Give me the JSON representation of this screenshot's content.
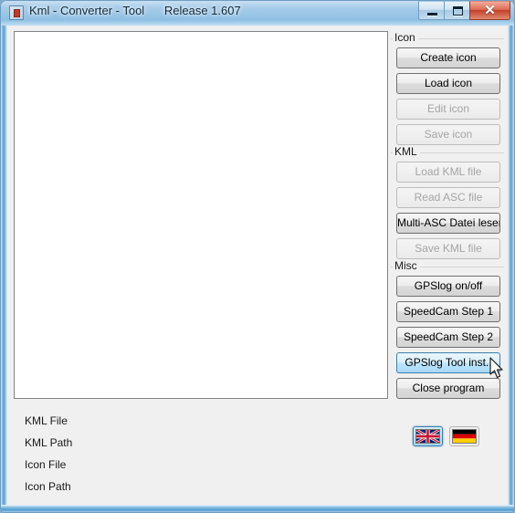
{
  "window": {
    "title": "Kml - Converter - Tool      Release 1.607",
    "app_icon_name": "kml-app-icon",
    "controls": {
      "minimize_label": "",
      "maximize_label": "",
      "close_label": "✕"
    }
  },
  "canvas": {
    "content": ""
  },
  "groups": [
    {
      "name": "icon",
      "label": "Icon",
      "buttons": [
        {
          "label": "Create icon",
          "state": "enabled"
        },
        {
          "label": "Load icon",
          "state": "enabled"
        },
        {
          "label": "Edit icon",
          "state": "disabled"
        },
        {
          "label": "Save icon",
          "state": "disabled"
        }
      ]
    },
    {
      "name": "kml",
      "label": "KML",
      "buttons": [
        {
          "label": "Load KML file",
          "state": "disabled"
        },
        {
          "label": "Read ASC file",
          "state": "disabled"
        },
        {
          "label": "Multi-ASC Datei lesen",
          "state": "enabled"
        },
        {
          "label": "Save KML file",
          "state": "disabled"
        }
      ]
    },
    {
      "name": "misc",
      "label": "Misc",
      "buttons": [
        {
          "label": "GPSlog on/off",
          "state": "enabled"
        },
        {
          "label": "SpeedCam Step 1",
          "state": "enabled"
        },
        {
          "label": "SpeedCam Step 2",
          "state": "enabled"
        },
        {
          "label": "GPSlog Tool  inst..",
          "state": "hover"
        },
        {
          "label": "Close program",
          "state": "enabled"
        }
      ]
    }
  ],
  "status": {
    "labels": [
      "KML File",
      "KML Path",
      "Icon File",
      "Icon Path"
    ]
  },
  "language": {
    "flags": [
      {
        "name": "flag-uk",
        "title": "English",
        "selected": true
      },
      {
        "name": "flag-de",
        "title": "Deutsch",
        "selected": false
      }
    ]
  },
  "colors": {
    "accent": "#3c7fb1",
    "titlebar_glass": "#9ec7e6",
    "client_bg": "#f0f0f0",
    "canvas_bg": "#ffffff",
    "close_button": "#c3402a"
  }
}
